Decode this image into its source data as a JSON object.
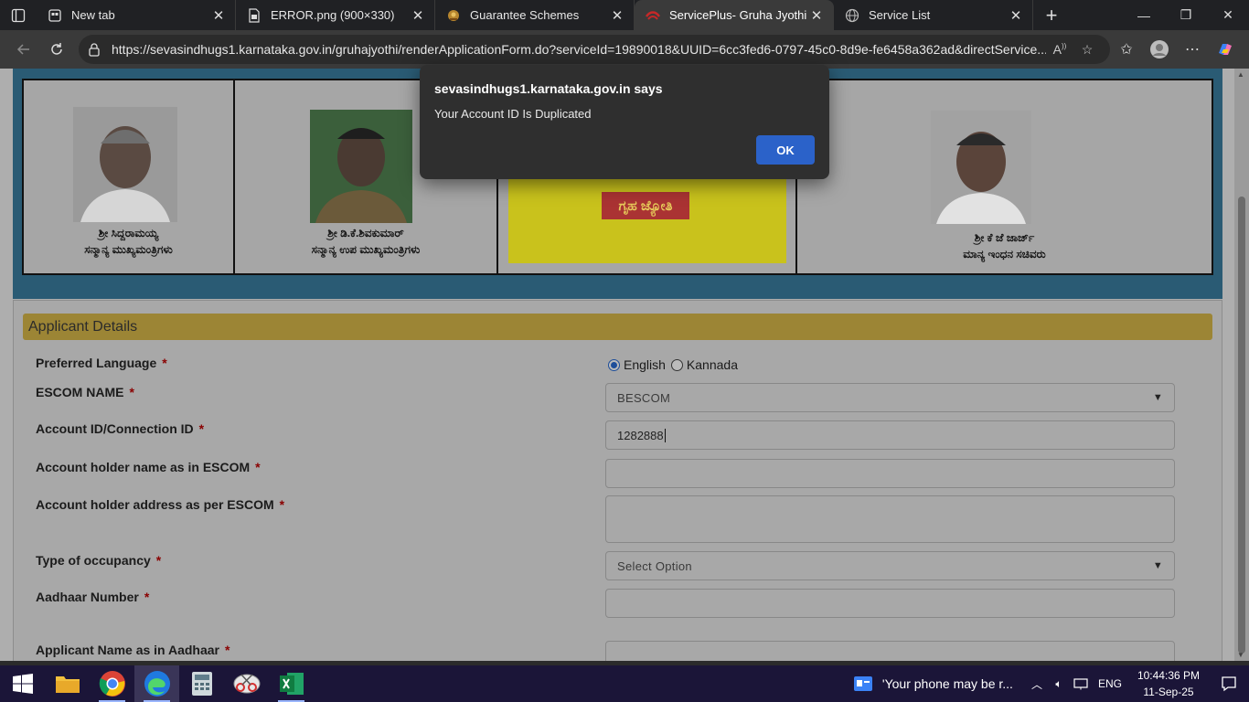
{
  "tabs": [
    {
      "title": "New tab",
      "icon": "newtab-icon"
    },
    {
      "title": "ERROR.png (900×330)",
      "icon": "document-icon"
    },
    {
      "title": "Guarantee Schemes",
      "icon": "emblem-icon"
    },
    {
      "title": "ServicePlus- Gruha Jyothi Sche",
      "icon": "serviceplus-icon",
      "active": true
    },
    {
      "title": "Service List",
      "icon": "globe-icon"
    }
  ],
  "address_bar": {
    "url": "https://sevasindhugs1.karnataka.gov.in/gruhajyothi/renderApplicationForm.do?serviceId=19890018&UUID=6cc3fed6-0797-45c0-8d9e-fe6458a362ad&directService..."
  },
  "banner": {
    "people": [
      {
        "name": "ಶ್ರೀ ಸಿದ್ದರಾಮಯ್ಯ",
        "role": "ಸನ್ಮಾನ್ಯ ಮುಖ್ಯಮಂತ್ರಿಗಳು"
      },
      {
        "name": "ಶ್ರೀ ಡಿ.ಕೆ.ಶಿವಕುಮಾರ್",
        "role": "ಸನ್ಮಾನ್ಯ ಉಪ ಮುಖ್ಯಮಂತ್ರಿಗಳು"
      },
      {
        "name": "ಶ್ರೀ ಕೆ ಜೆ ಜಾರ್ಜ್",
        "role": "ಮಾನ್ಯ ಇಂಧನ ಸಚಿವರು"
      }
    ],
    "logo_text": "ಗೃಹ ಜ್ಯೋತಿ"
  },
  "form": {
    "section_title": "Applicant Details",
    "required_mark": "*",
    "fields": {
      "preferred_language": {
        "label": "Preferred Language",
        "options": [
          "English",
          "Kannada"
        ],
        "selected": "English"
      },
      "escom_name": {
        "label": "ESCOM NAME",
        "value": "BESCOM"
      },
      "account_id": {
        "label": "Account ID/Connection ID",
        "value": "1282888"
      },
      "holder_name": {
        "label": "Account holder name as in ESCOM",
        "value": ""
      },
      "holder_address": {
        "label": "Account holder address as per ESCOM",
        "value": ""
      },
      "occupancy": {
        "label": "Type of occupancy",
        "value": "Select Option"
      },
      "aadhaar": {
        "label": "Aadhaar Number",
        "value": ""
      },
      "applicant_name": {
        "label": "Applicant Name as in Aadhaar",
        "value": ""
      }
    }
  },
  "dialog": {
    "title": "sevasindhugs1.karnataka.gov.in says",
    "message": "Your Account ID Is Duplicated",
    "ok_label": "OK"
  },
  "taskbar": {
    "apps": [
      "file-explorer-icon",
      "chrome-icon",
      "edge-icon",
      "calculator-icon",
      "snipping-tool-icon",
      "excel-icon"
    ],
    "notification": "'Your phone may be r...",
    "language": "ENG",
    "time": "10:44:36 PM",
    "date": "11-Sep-25"
  },
  "colors": {
    "dialog_ok": "#2b62c9",
    "section_header": "#9c8535",
    "banner": "#2a5b74",
    "taskbar": "#1b1538"
  }
}
